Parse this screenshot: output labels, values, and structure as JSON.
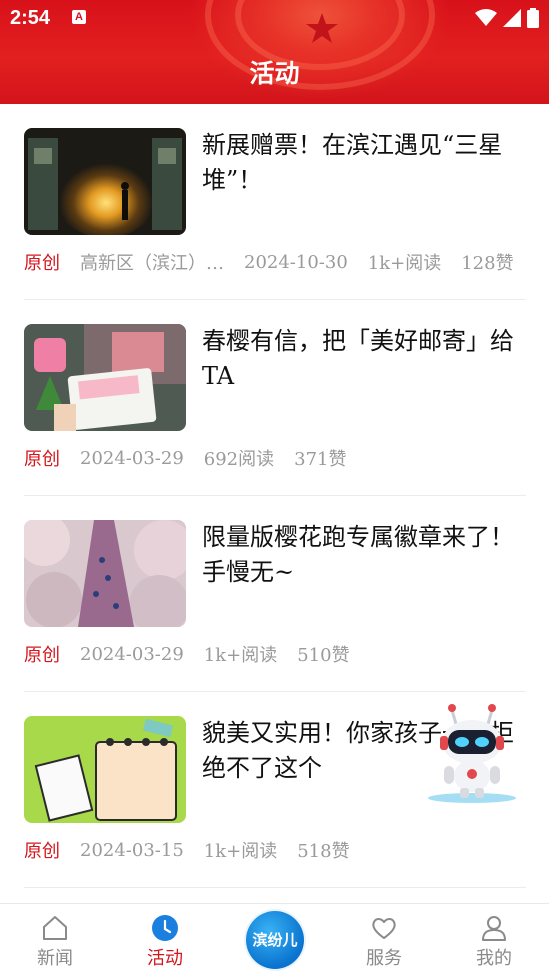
{
  "status_bar": {
    "time": "2:54",
    "app_badge": "A"
  },
  "header": {
    "title": "活动"
  },
  "articles": [
    {
      "title": "新展赠票！在滨江遇见“三星堆”！",
      "tag": "原创",
      "source": "高新区（滨江）…",
      "date": "2024-10-30",
      "reads": "1k+阅读",
      "likes": "128赞"
    },
    {
      "title": "春樱有信，把「美好邮寄」给TA",
      "tag": "原创",
      "date": "2024-03-29",
      "reads": "692阅读",
      "likes": "371赞"
    },
    {
      "title": "限量版樱花跑专属徽章来了！手慢无~",
      "tag": "原创",
      "date": "2024-03-29",
      "reads": "1k+阅读",
      "likes": "510赞"
    },
    {
      "title": "貌美又实用！你家孩子一定拒绝不了这个",
      "tag": "原创",
      "date": "2024-03-15",
      "reads": "1k+阅读",
      "likes": "518赞"
    }
  ],
  "tabbar": {
    "tabs": [
      {
        "label": "新闻",
        "icon": "home-icon"
      },
      {
        "label": "活动",
        "icon": "clock-icon",
        "active": true
      },
      {
        "label": "",
        "icon": "center-logo"
      },
      {
        "label": "服务",
        "icon": "heart-icon"
      },
      {
        "label": "我的",
        "icon": "user-icon"
      }
    ],
    "center_text": "滨纷儿"
  },
  "colors": {
    "brand_red": "#d4151c",
    "header_red": "#d8111a",
    "muted": "#9a9a9a"
  }
}
